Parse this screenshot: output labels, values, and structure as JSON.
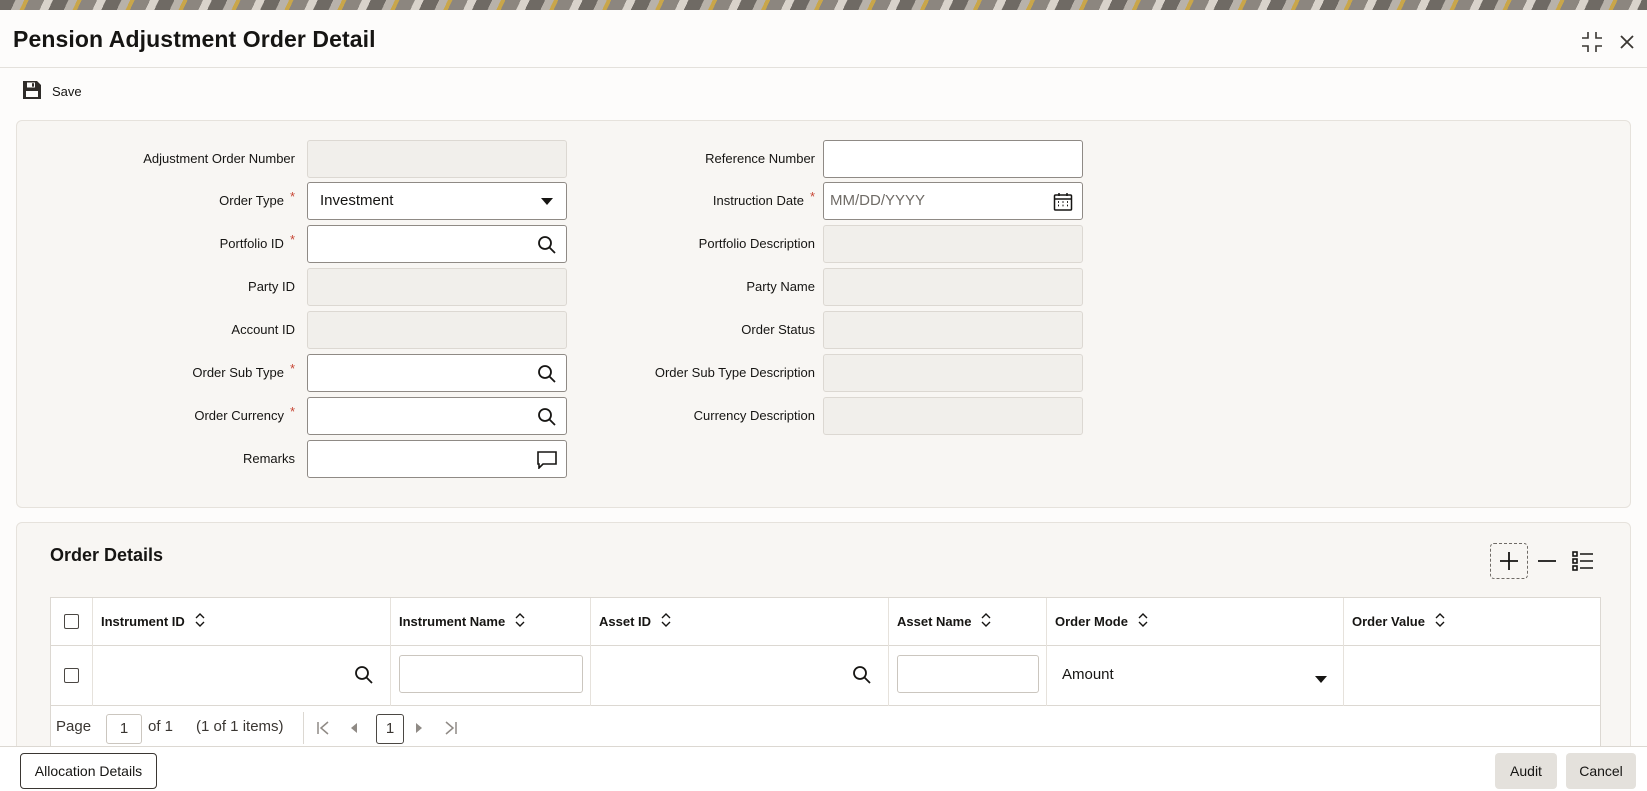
{
  "window": {
    "title": "Pension Adjustment Order Detail",
    "expand_icon": "expand-icon",
    "close_icon": "close-icon"
  },
  "toolbar": {
    "save_label": "Save",
    "save_icon": "floppy-disk-icon"
  },
  "form": {
    "left": [
      {
        "label": "Adjustment Order Number",
        "required": false,
        "type": "readonly",
        "value": ""
      },
      {
        "label": "Order Type",
        "required": true,
        "type": "select",
        "value": "Investment"
      },
      {
        "label": "Portfolio ID",
        "required": true,
        "type": "lookup",
        "value": ""
      },
      {
        "label": "Party ID",
        "required": false,
        "type": "readonly",
        "value": ""
      },
      {
        "label": "Account ID",
        "required": false,
        "type": "readonly",
        "value": ""
      },
      {
        "label": "Order Sub Type",
        "required": true,
        "type": "lookup",
        "value": ""
      },
      {
        "label": "Order Currency",
        "required": true,
        "type": "lookup",
        "value": ""
      },
      {
        "label": "Remarks",
        "required": false,
        "type": "remarks",
        "value": ""
      }
    ],
    "right": [
      {
        "label": "Reference Number",
        "required": false,
        "type": "text",
        "value": ""
      },
      {
        "label": "Instruction Date",
        "required": true,
        "type": "date",
        "placeholder": "MM/DD/YYYY"
      },
      {
        "label": "Portfolio Description",
        "required": false,
        "type": "readonly",
        "value": ""
      },
      {
        "label": "Party Name",
        "required": false,
        "type": "readonly",
        "value": ""
      },
      {
        "label": "Order Status",
        "required": false,
        "type": "readonly",
        "value": ""
      },
      {
        "label": "Order Sub Type Description",
        "required": false,
        "type": "readonly",
        "value": ""
      },
      {
        "label": "Currency Description",
        "required": false,
        "type": "readonly",
        "value": ""
      }
    ],
    "required_marker": "*"
  },
  "order_details": {
    "title": "Order Details",
    "columns": [
      "Instrument ID",
      "Instrument Name",
      "Asset ID",
      "Asset Name",
      "Order Mode",
      "Order Value"
    ],
    "rows": [
      {
        "instrument_id": "",
        "instrument_name": "",
        "asset_id": "",
        "asset_name": "",
        "order_mode": "Amount",
        "order_value": ""
      }
    ],
    "pager": {
      "page_label": "Page",
      "page_value": "1",
      "of_label": "of 1",
      "items_label": "(1 of 1 items)",
      "current_page": "1"
    }
  },
  "footer": {
    "allocation_label": "Allocation Details",
    "audit_label": "Audit",
    "cancel_label": "Cancel"
  },
  "colors": {
    "required": "#c74634",
    "panel": "#f8f6f3",
    "readonly_field": "#f1efeb"
  }
}
